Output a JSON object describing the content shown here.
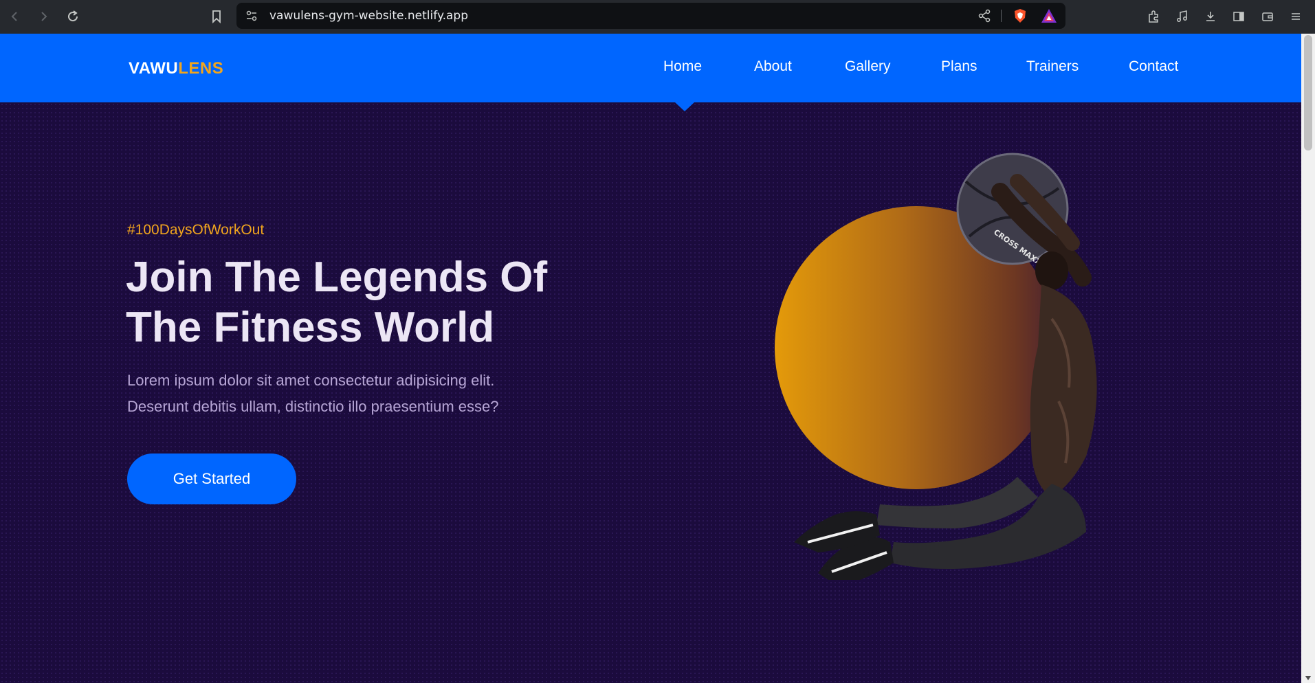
{
  "browser": {
    "url": "vawulens-gym-website.netlify.app"
  },
  "site": {
    "logo_main": "VAWU",
    "logo_accent": "LENS",
    "nav": [
      "Home",
      "About",
      "Gallery",
      "Plans",
      "Trainers",
      "Contact"
    ],
    "active_nav": "Home"
  },
  "hero": {
    "tagline": "#100DaysOfWorkOut",
    "headline_line1": "Join The Legends Of",
    "headline_line2": "The Fitness World",
    "subtext_line1": "Lorem ipsum dolor sit amet consectetur adipisicing elit.",
    "subtext_line2": "Deserunt debitis ullam, distinctio illo praesentium esse?",
    "cta_label": "Get Started",
    "ball_text": "CROSS MAXX"
  },
  "colors": {
    "header_blue": "#0066ff",
    "accent_orange": "#f0a51e",
    "hero_bg": "#1b0b3d"
  }
}
